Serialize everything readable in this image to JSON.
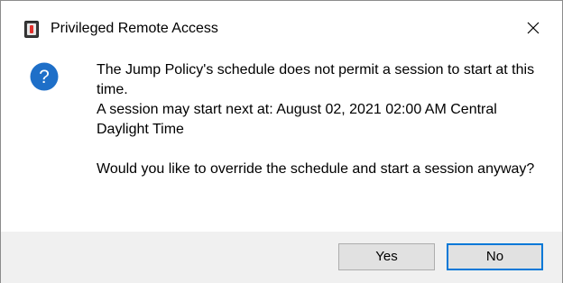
{
  "window": {
    "title": "Privileged Remote Access",
    "app_icon": "remote-access-app-icon",
    "close_icon": "close-icon"
  },
  "message": {
    "icon": "question-icon",
    "line1": "The Jump Policy's schedule does not permit a session to start at this time.",
    "line2": "A session may start next at: August 02, 2021 02:00 AM Central Daylight Time",
    "line3": "Would you like to override the schedule and start a session anyway?"
  },
  "buttons": {
    "yes_label": "Yes",
    "no_label": "No"
  },
  "colors": {
    "accent": "#0078d7",
    "footer_bg": "#f0f0f0",
    "button_bg": "#e1e1e1",
    "question_icon": "#1e6fc8"
  }
}
